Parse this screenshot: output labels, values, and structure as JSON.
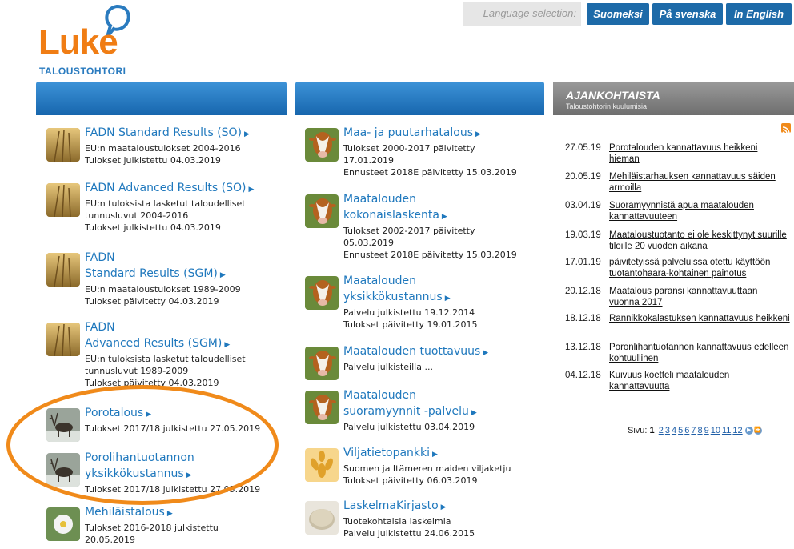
{
  "logo": {
    "word": "Luke",
    "subtitle": "TALOUSTOHTORI"
  },
  "language": {
    "label": "Language selection:",
    "options": [
      "Suomeksi",
      "På svenska",
      "In English"
    ]
  },
  "news_header": {
    "title": "AJANKOHTAISTA",
    "subtitle": "Taloustohtorin kuulumisia"
  },
  "left_items": [
    {
      "title_lines": [
        "FADN Standard Results (SO)"
      ],
      "meta": "EU:n maataloustulokset 2004-2016\nTulokset julkistettu 04.03.2019",
      "icon": "wheat-icon"
    },
    {
      "title_lines": [
        "FADN Advanced Results (SO)"
      ],
      "meta": "EU:n tuloksista lasketut taloudelliset\ntunnusluvut 2004-2016\nTulokset julkistettu 04.03.2019",
      "icon": "wheat-icon"
    },
    {
      "title_lines": [
        "FADN",
        "Standard Results (SGM)"
      ],
      "meta": "EU:n maataloustulokset 1989-2009\nTulokset päivitetty 04.03.2019",
      "icon": "wheat-icon"
    },
    {
      "title_lines": [
        "FADN",
        "Advanced Results (SGM)"
      ],
      "meta": "EU:n tuloksista lasketut taloudelliset\ntunnusluvut 1989-2009\nTulokset päivitetty 04.03.2019",
      "icon": "wheat-icon"
    },
    {
      "title_lines": [
        "Porotalous"
      ],
      "meta": "Tulokset 2017/18 julkistettu 27.05.2019",
      "icon": "reindeer-icon"
    },
    {
      "title_lines": [
        "Porolihantuotannon",
        "yksikkökustannus"
      ],
      "meta": "Tulokset 2017/18 julkistettu 27.05.2019",
      "icon": "reindeer-icon"
    },
    {
      "title_lines": [
        "Mehiläistalous"
      ],
      "meta": "Tulokset 2016-2018 julkistettu\n20.05.2019",
      "icon": "bee-flower-icon"
    }
  ],
  "mid_items": [
    {
      "title_lines": [
        "Maa- ja puutarhatalous"
      ],
      "meta": "Tulokset 2000-2017 päivitetty\n17.01.2019\nEnnusteet 2018E päivitetty 15.03.2019",
      "icon": "cow-icon"
    },
    {
      "title_lines": [
        "Maatalouden",
        "kokonaislaskenta"
      ],
      "meta": "Tulokset 2002-2017 päivitetty\n05.03.2019\nEnnusteet 2018E päivitetty 15.03.2019",
      "icon": "cow-icon"
    },
    {
      "title_lines": [
        "Maatalouden",
        "yksikkökustannus"
      ],
      "meta": "Palvelu julkistettu 19.12.2014\nTulokset päivitetty 19.01.2015",
      "icon": "cow-icon"
    },
    {
      "title_lines": [
        "Maatalouden tuottavuus"
      ],
      "meta": "Palvelu julkisteilla ...",
      "icon": "cow-icon"
    },
    {
      "title_lines": [
        "Maatalouden",
        "suoramyynnit -palvelu"
      ],
      "meta": "Palvelu julkistettu 03.04.2019",
      "icon": "cow-icon"
    },
    {
      "title_lines": [
        "Viljatietopankki"
      ],
      "meta": "Suomen ja Itämeren maiden viljaketju\nTulokset päivitetty 06.03.2019",
      "icon": "grain-icon"
    },
    {
      "title_lines": [
        "LaskelmaKirjasto"
      ],
      "meta": "Tuotekohtaisia laskelmia\nPalvelu julkistettu 24.06.2015",
      "icon": "coin-icon"
    }
  ],
  "news": [
    {
      "date": "27.05.19",
      "text": "Porotalouden kannattavuus heikkeni hieman"
    },
    {
      "date": "20.05.19",
      "text": "Mehiläistarhauksen kannattavuus säiden armoilla"
    },
    {
      "date": "03.04.19",
      "text": "Suoramyynnistä apua maatalouden kannattavuuteen"
    },
    {
      "date": "19.03.19",
      "text": "Maataloustuotanto ei ole keskittynyt suurille tiloille 20 vuoden aikana"
    },
    {
      "date": "17.01.19",
      "text": "päivitetyissä palveluissa otettu käyttöön tuotantohaara-kohtainen painotus"
    },
    {
      "date": "20.12.18",
      "text": "Maatalous paransi kannattavuuttaan vuonna 2017"
    },
    {
      "date": "18.12.18",
      "text": "Rannikkokalastuksen kannattavuus heikkeni"
    },
    {
      "date": "13.12.18",
      "text": "Poronlihantuotannon kannattavuus edelleen kohtuullinen"
    },
    {
      "date": "04.12.18",
      "text": "Kuivuus koetteli maatalouden kannattavuutta"
    }
  ],
  "pager": {
    "label": "Sivu:",
    "current": "1",
    "pages": [
      "2",
      "3",
      "4",
      "5",
      "6",
      "7",
      "8",
      "9",
      "10",
      "11",
      "12"
    ]
  },
  "colors": {
    "brand_orange": "#f07d14",
    "link_blue": "#1f78bd",
    "bar_blue": "#1766ad"
  }
}
